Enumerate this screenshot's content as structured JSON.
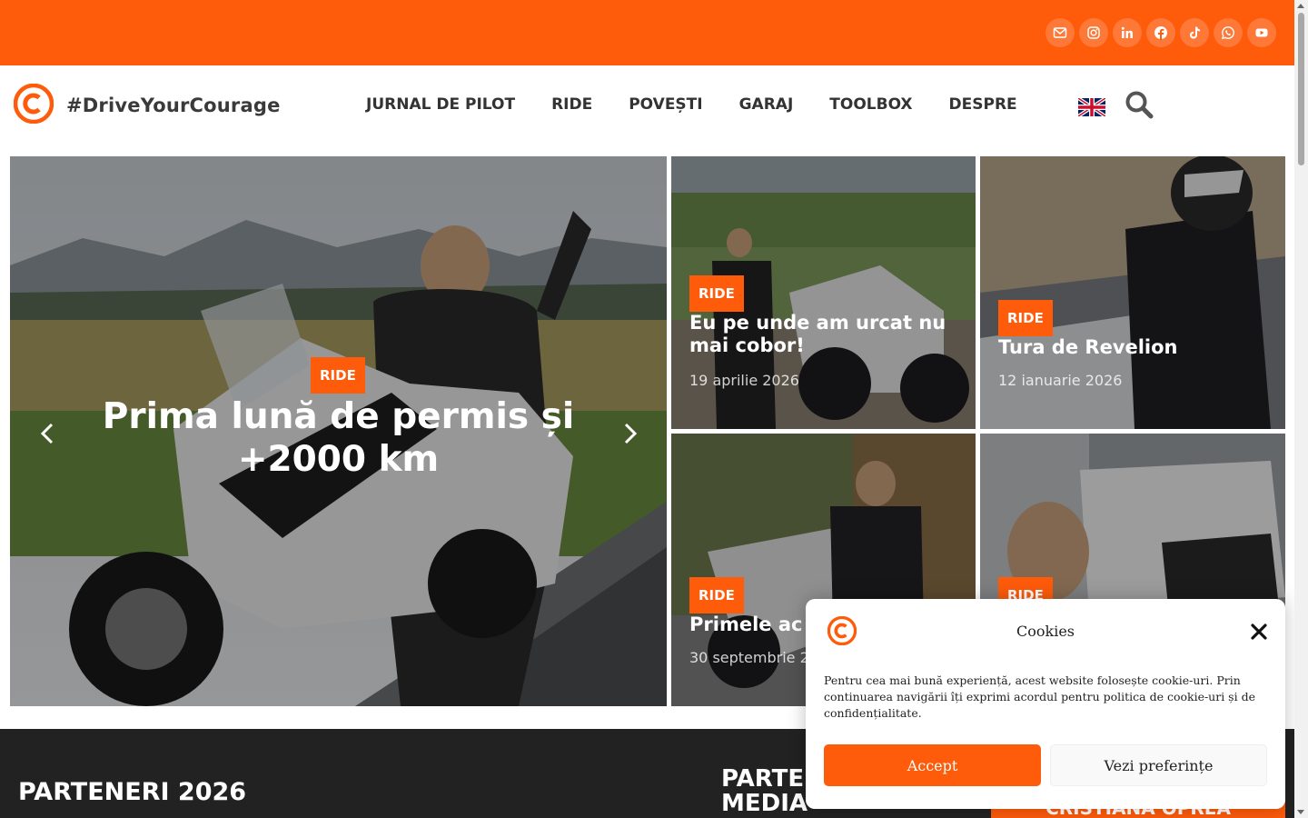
{
  "colors": {
    "accent": "#fe5b0b",
    "dark": "#222222"
  },
  "social": [
    "mail-icon",
    "instagram-icon",
    "linkedin-icon",
    "facebook-icon",
    "tiktok-icon",
    "whatsapp-icon",
    "youtube-icon"
  ],
  "header": {
    "brand": "#DriveYourCourage",
    "nav": [
      "JURNAL DE PILOT",
      "RIDE",
      "POVEȘTI",
      "GARAJ",
      "TOOLBOX",
      "DESPRE"
    ],
    "language_flag": "uk-flag-icon"
  },
  "hero": {
    "main": {
      "badge": "RIDE",
      "title": "Prima lună de permis și +2000 km"
    },
    "tiles": [
      {
        "badge": "RIDE",
        "title": "Eu pe unde am urcat nu mai cobor!",
        "date": "19 aprilie 2026"
      },
      {
        "badge": "RIDE",
        "title": "Tura de Revelion",
        "date": "12 ianuarie 2026"
      },
      {
        "badge": "RIDE",
        "title": "Primele ac",
        "date": "30 septembrie 2"
      },
      {
        "badge": "RIDE"
      }
    ]
  },
  "footer": {
    "partners_heading": "PARTENERI 2026",
    "media_heading": "PARTE MEDIA",
    "button_text": "CRISTIANA OPREA"
  },
  "cookie": {
    "title": "Cookies",
    "text": "Pentru cea mai bună experiență, acest website folosește cookie-uri. Prin continuarea navigării îți exprimi acordul pentru politica de cookie-uri și de confidențialitate.",
    "accept": "Accept",
    "preferences": "Vezi preferințe"
  }
}
